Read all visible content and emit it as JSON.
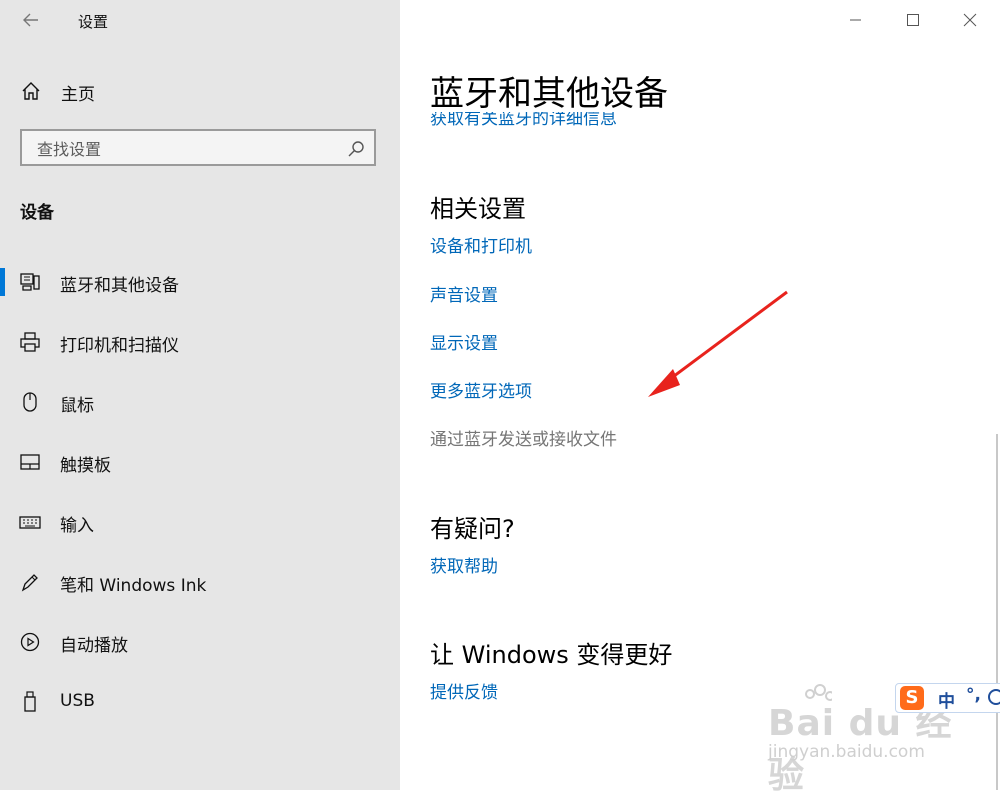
{
  "window": {
    "app_title": "设置",
    "controls": {
      "minimize_icon": "minimize-icon",
      "maximize_icon": "maximize-icon",
      "close_icon": "close-icon"
    }
  },
  "sidebar": {
    "home_label": "主页",
    "search": {
      "placeholder": "查找设置",
      "value": ""
    },
    "section_title": "设备",
    "items": [
      {
        "label": "蓝牙和其他设备",
        "icon": "bluetooth-devices-icon",
        "selected": true
      },
      {
        "label": "打印机和扫描仪",
        "icon": "printer-icon",
        "selected": false
      },
      {
        "label": "鼠标",
        "icon": "mouse-icon",
        "selected": false
      },
      {
        "label": "触摸板",
        "icon": "touchpad-icon",
        "selected": false
      },
      {
        "label": "输入",
        "icon": "keyboard-icon",
        "selected": false
      },
      {
        "label": "笔和 Windows Ink",
        "icon": "pen-icon",
        "selected": false
      },
      {
        "label": "自动播放",
        "icon": "autoplay-icon",
        "selected": false
      },
      {
        "label": "USB",
        "icon": "usb-icon",
        "selected": false
      }
    ]
  },
  "main": {
    "page_title": "蓝牙和其他设备",
    "clipped_link": "获取有关蓝牙的详细信息",
    "related_settings": {
      "heading": "相关设置",
      "links": [
        "设备和打印机",
        "声音设置",
        "显示设置",
        "更多蓝牙选项"
      ],
      "disabled_text": "通过蓝牙发送或接收文件"
    },
    "questions": {
      "heading": "有疑问?",
      "link": "获取帮助"
    },
    "feedback": {
      "heading": "让 Windows 变得更好",
      "link": "提供反馈"
    }
  },
  "ime_toolbar": {
    "logo": "S",
    "mode": "中",
    "punct": "°,"
  },
  "watermark": {
    "brand": "Bai du 经验",
    "url": "jingyan.baidu.com"
  },
  "colors": {
    "accent": "#0078d7",
    "link": "#0067b8",
    "sidebar_bg": "#e6e6e6",
    "annotation_arrow": "#e8231d"
  }
}
